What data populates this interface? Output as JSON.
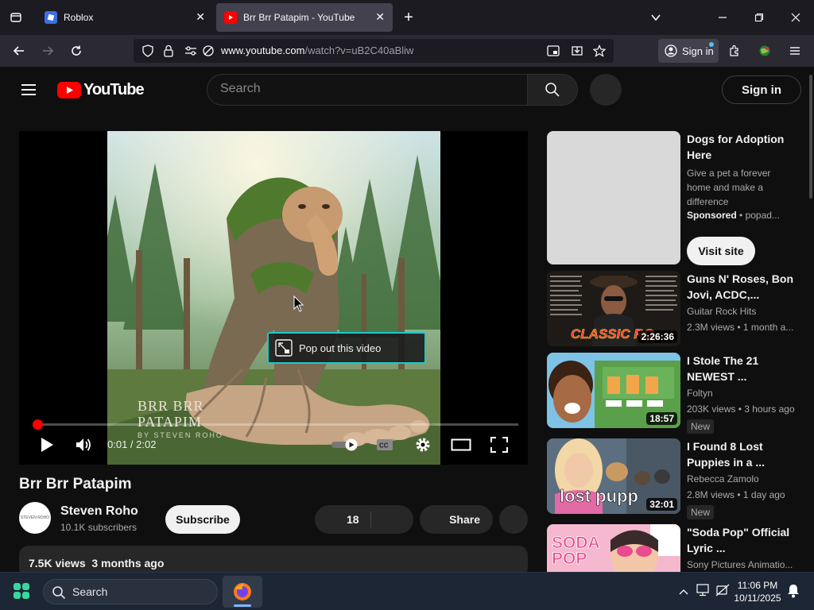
{
  "browser": {
    "tabs": [
      {
        "label": "Roblox",
        "active": false
      },
      {
        "label": "Brr Brr Patapim - YouTube",
        "active": true
      }
    ],
    "url_host": "www.youtube.com",
    "url_path": "/watch?v=uB2C40aBliw",
    "sign_in_label": "Sign in"
  },
  "youtube": {
    "logo_text": "YouTube",
    "search_placeholder": "Search",
    "sign_in_label": "Sign in"
  },
  "player": {
    "timecode": "0:01 / 2:02",
    "progress_fraction": 0.008,
    "popout_label": "Pop out this video",
    "overlay_title_line1": "BRR BRR",
    "overlay_title_line2": "PATAPIM",
    "overlay_byline": "BY STEVEN ROHO"
  },
  "video": {
    "title": "Brr Brr Patapim",
    "channel_name": "Steven Roho",
    "channel_avatar_text": "STEVEN ROHO",
    "subscribers": "10.1K subscribers",
    "subscribe_label": "Subscribe",
    "likes": "18",
    "share_label": "Share",
    "views_and_date": "7.5K views  3 months ago"
  },
  "sidebar": {
    "ad": {
      "title": "Dogs for Adoption Here",
      "description": "Give a pet a forever home and make a difference",
      "sponsored_label": "Sponsored",
      "advertiser": "popad...",
      "cta": "Visit site"
    },
    "videos": [
      {
        "title": "Guns N' Roses, Bon Jovi, ACDC,...",
        "channel": "Guitar Rock Hits",
        "stats": "2.3M views • 1 month a...",
        "duration": "2:26:36",
        "thumb_text": "CLASSIC RO",
        "badge": ""
      },
      {
        "title": "I Stole The 21 NEWEST ...",
        "channel": "Foltyn",
        "stats": "203K views • 3 hours ago",
        "duration": "18:57",
        "thumb_text": "",
        "badge": "New"
      },
      {
        "title": "I Found 8 Lost Puppies in a ...",
        "channel": "Rebecca Zamolo",
        "stats": "2.8M views • 1 day ago",
        "duration": "32:01",
        "thumb_text": "lost pupp",
        "badge": "New"
      },
      {
        "title": "\"Soda Pop\" Official Lyric ...",
        "channel": "Sony Pictures Animatio...",
        "stats": "",
        "duration": "",
        "thumb_text": "SODA POP",
        "badge": ""
      }
    ]
  },
  "taskbar": {
    "search_label": "Search",
    "time": "11:06 PM",
    "date": "10/11/2025"
  },
  "colors": {
    "yt_red": "#ff0000",
    "background": "#0f0f0f",
    "browser_tabbar": "#1c1b22",
    "browser_navbar": "#2b2a33",
    "popout_border": "#1ec8c8"
  }
}
